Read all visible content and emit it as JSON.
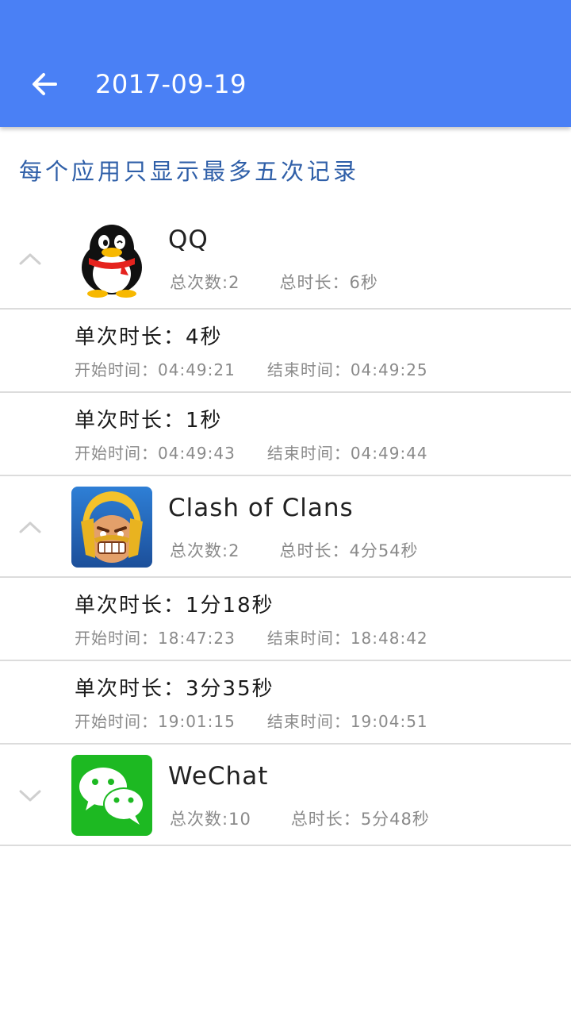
{
  "header": {
    "title": "2017-09-19",
    "back_icon": "arrow-left-icon",
    "bg_color": "#4a80f5"
  },
  "notice": "每个应用只显示最多五次记录",
  "apps": [
    {
      "name": "QQ",
      "icon": "qq-penguin-icon",
      "expanded": true,
      "count_label": "总次数:",
      "count": "2",
      "total_label": "总时长：",
      "total": "6秒",
      "sessions": [
        {
          "dur_label": "单次时长：",
          "dur": "4秒",
          "start_label": "开始时间：",
          "start": "04:49:21",
          "end_label": "结束时间：",
          "end": "04:49:25"
        },
        {
          "dur_label": "单次时长：",
          "dur": "1秒",
          "start_label": "开始时间：",
          "start": "04:49:43",
          "end_label": "结束时间：",
          "end": "04:49:44"
        }
      ]
    },
    {
      "name": "Clash of Clans",
      "icon": "clash-of-clans-barbarian-icon",
      "expanded": true,
      "count_label": "总次数:",
      "count": "2",
      "total_label": "总时长：",
      "total": "4分54秒",
      "sessions": [
        {
          "dur_label": "单次时长：",
          "dur": "1分18秒",
          "start_label": "开始时间：",
          "start": "18:47:23",
          "end_label": "结束时间：",
          "end": "18:48:42"
        },
        {
          "dur_label": "单次时长：",
          "dur": "3分35秒",
          "start_label": "开始时间：",
          "start": "19:01:15",
          "end_label": "结束时间：",
          "end": "19:04:51"
        }
      ]
    },
    {
      "name": "WeChat",
      "icon": "wechat-bubbles-icon",
      "expanded": false,
      "count_label": "总次数:",
      "count": "10",
      "total_label": "总时长：",
      "total": "5分48秒",
      "sessions": []
    }
  ]
}
